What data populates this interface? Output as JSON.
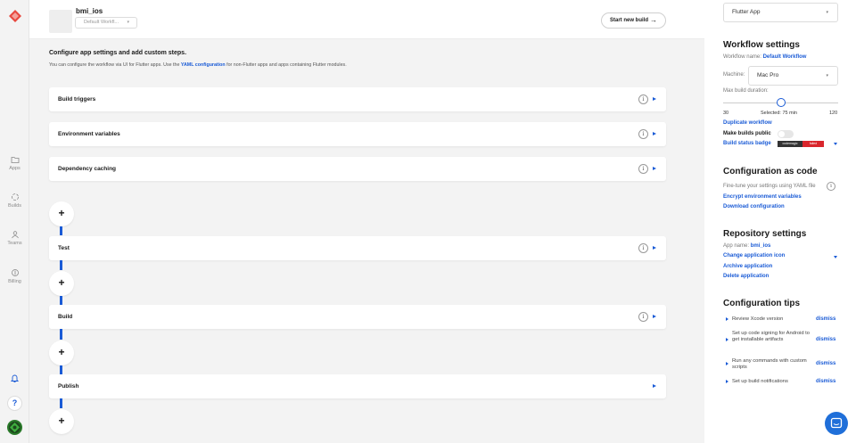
{
  "nav": {
    "items": [
      {
        "label": "Apps",
        "icon": "folder-icon"
      },
      {
        "label": "Builds",
        "icon": "builds-icon"
      },
      {
        "label": "Teams",
        "icon": "teams-icon"
      },
      {
        "label": "Billing",
        "icon": "billing-icon"
      }
    ],
    "help_label": "?"
  },
  "header": {
    "app_name": "bmi_ios",
    "workflow_select": "Default Workfl...",
    "start_build_label": "Start new build"
  },
  "config": {
    "title": "Configure app settings and add custom steps.",
    "desc_prefix": "You can configure the workflow via UI for Flutter apps. Use the ",
    "desc_link": "YAML configuration",
    "desc_suffix": " for non-Flutter apps and apps containing Flutter modules."
  },
  "cards": [
    {
      "label": "Build triggers"
    },
    {
      "label": "Environment variables"
    },
    {
      "label": "Dependency caching"
    },
    {
      "label": "Test"
    },
    {
      "label": "Build"
    },
    {
      "label": "Publish"
    }
  ],
  "plus_label": "+",
  "info_label": "i",
  "right": {
    "project_type": "Flutter App",
    "workflow_settings": {
      "heading": "Workflow settings",
      "name_label": "Workflow name: ",
      "name_value": "Default Workflow",
      "machine_label": "Machine:",
      "machine_value": "Mac Pro",
      "duration_label": "Max build duration:",
      "duration_min": "30",
      "duration_selected": "Selected: 75 min",
      "duration_max": "120",
      "duration_value": 75,
      "duplicate": "Duplicate workflow",
      "public": "Make builds public",
      "badge": "Build status badge",
      "badge_left": "codemagic",
      "badge_right": "failed"
    },
    "config_as_code": {
      "heading": "Configuration as code",
      "desc": "Fine-tune your settings using YAML file",
      "encrypt": "Encrypt environment variables",
      "download": "Download configuration"
    },
    "repository": {
      "heading": "Repository settings",
      "app_name_label": "App name: ",
      "app_name_value": "bmi_ios",
      "change_icon": "Change application icon",
      "archive": "Archive application",
      "delete": "Delete application"
    },
    "tips": {
      "heading": "Configuration tips",
      "items": [
        {
          "text": "Review Xcode version",
          "action": "dismiss"
        },
        {
          "text": "Set up code signing for Android to get installable artifacts",
          "action": "dismiss"
        },
        {
          "text": "Run any commands with custom scripts",
          "action": "dismiss"
        },
        {
          "text": "Set up build notifications",
          "action": "dismiss"
        }
      ]
    }
  },
  "colors": {
    "accent": "#1a5bd6",
    "logo": "#e8483f",
    "badge_fail": "#d9262c"
  }
}
